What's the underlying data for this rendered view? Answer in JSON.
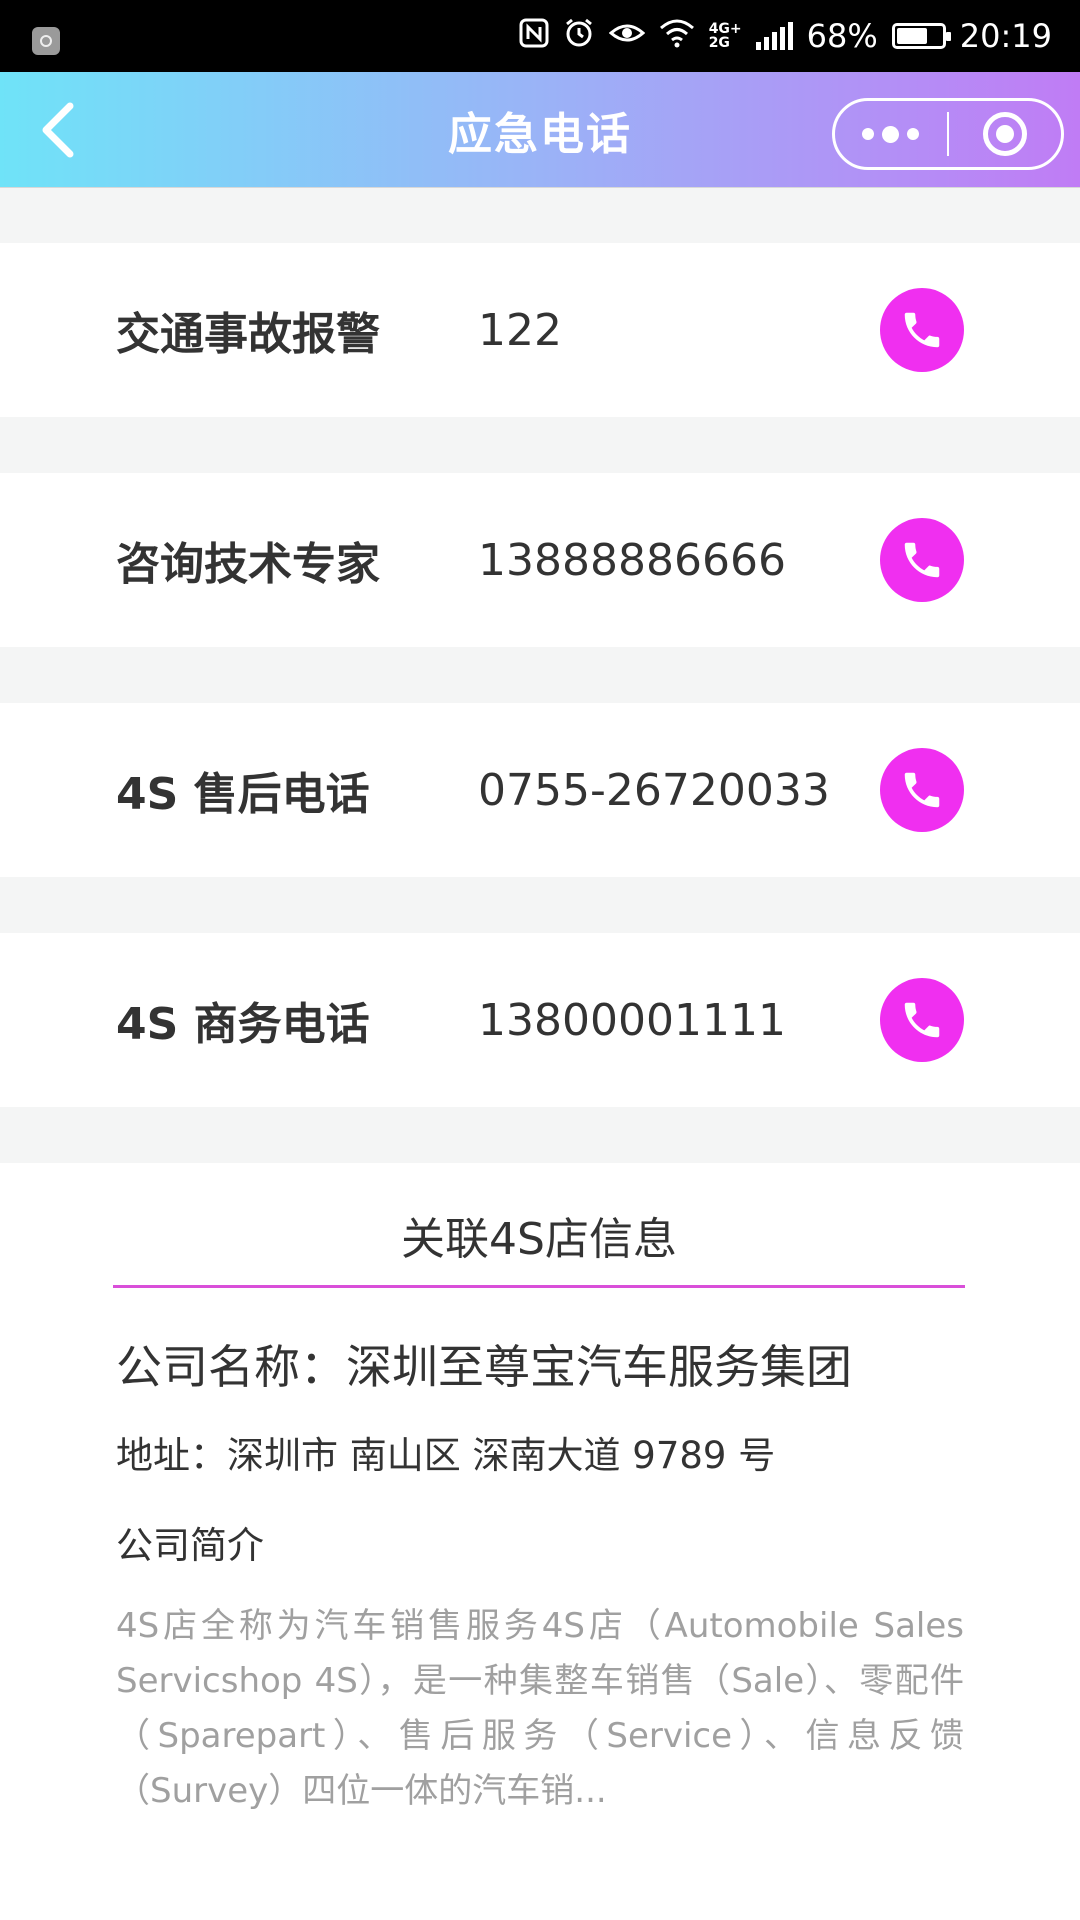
{
  "status_bar": {
    "network_top": "4G+",
    "network_bottom": "2G",
    "battery": "68%",
    "battery_level": 0.68,
    "time": "20:19",
    "icons": [
      "nfc-icon",
      "alarm-icon",
      "eye-icon",
      "wifi-icon",
      "signal-icon",
      "battery-icon"
    ]
  },
  "nav": {
    "title": "应急电话",
    "gradient": [
      "#6fe3f8",
      "#c07cf5"
    ]
  },
  "contacts": [
    {
      "name": "交通事故报警",
      "number": "122"
    },
    {
      "name": "咨询技术专家",
      "number": "13888886666"
    },
    {
      "name": "4S 售后电话",
      "number": "0755-26720033"
    },
    {
      "name": "4S 商务电话",
      "number": "13800001111"
    }
  ],
  "shop": {
    "title": "关联4S店信息",
    "company_name": "公司名称：深圳至尊宝汽车服务集团",
    "address": "地址：深圳市 南山区 深南大道 9789 号",
    "intro_heading": "公司简介",
    "intro_text": "4S店全称为汽车销售服务4S店（Automobile Sales Servicshop 4S），是一种集整车销售（Sale）、零配件（Sparepart）、售后服务（Service）、信息反馈（Survey）四位一体的汽车销..."
  },
  "colors": {
    "call_button": "#f02ff0",
    "underline": "#d94fd9",
    "background": "#f4f5f5"
  }
}
